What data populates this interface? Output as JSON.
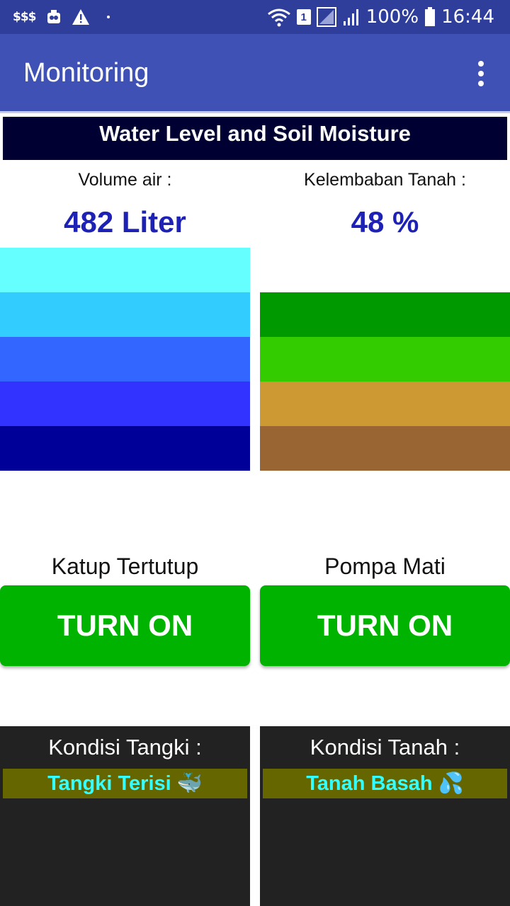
{
  "status_bar": {
    "carrier_icon_text": "$$$",
    "battery": "100%",
    "time": "16:44",
    "sim_slot": "1"
  },
  "app_bar": {
    "title": "Monitoring"
  },
  "banner": "Water Level and Soil Moisture",
  "water": {
    "label": "Volume air :",
    "value": "482 Liter",
    "levels": [
      "#66ffff",
      "#33ccff",
      "#3366ff",
      "#3333ff",
      "#000099"
    ]
  },
  "soil": {
    "label": "Kelembaban Tanah :",
    "value": "48 %",
    "levels": [
      "#009900",
      "#33cc00",
      "#cc9933",
      "#996633"
    ]
  },
  "valve": {
    "status": "Katup Tertutup",
    "button": "TURN ON"
  },
  "pump": {
    "status": "Pompa Mati",
    "button": "TURN ON"
  },
  "tank_panel": {
    "title": "Kondisi Tangki :",
    "state": "Tangki Terisi 🐳"
  },
  "soil_panel": {
    "title": "Kondisi Tanah :",
    "state": "Tanah Basah 💦"
  },
  "colors": {
    "status_bar": "#2f3e9b",
    "app_bar": "#3f51b5",
    "button": "#00b300",
    "value_text": "#1d22b5",
    "panel_bg": "#222222",
    "strip_bg": "#666600",
    "strip_text": "#33ffff"
  }
}
